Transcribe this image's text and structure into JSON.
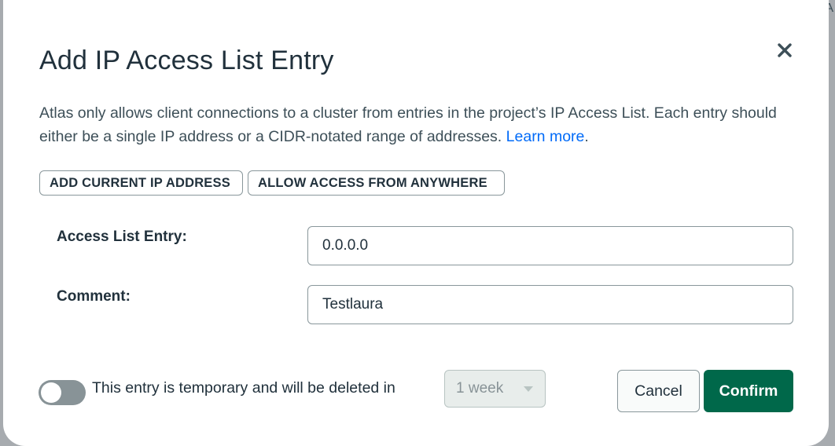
{
  "background": {
    "partial_letter": "A"
  },
  "dialog": {
    "title": "Add IP Access List Entry",
    "close_icon": "close-icon",
    "description": "Atlas only allows client connections to a cluster from entries in the project’s IP Access List. Each entry should either be a single IP address or a CIDR-notated range of addresses.",
    "learn_more_link": "Learn more",
    "learn_more_suffix": ".",
    "quick_buttons": {
      "add_current_ip": "ADD CURRENT IP ADDRESS",
      "allow_anywhere": "ALLOW ACCESS FROM ANYWHERE"
    },
    "fields": {
      "entry_label": "Access List Entry:",
      "entry_value": "0.0.0.0",
      "comment_label": "Comment:",
      "comment_value": "Testlaura"
    },
    "temporary": {
      "toggle_on": false,
      "label": "This entry is temporary and will be deleted in",
      "duration_value": "1 week"
    },
    "actions": {
      "cancel_label": "Cancel",
      "confirm_label": "Confirm"
    },
    "colors": {
      "primary_green": "#00684a",
      "link_blue": "#016bf8",
      "text_dark": "#21313c",
      "border_gray": "#89979b"
    }
  }
}
